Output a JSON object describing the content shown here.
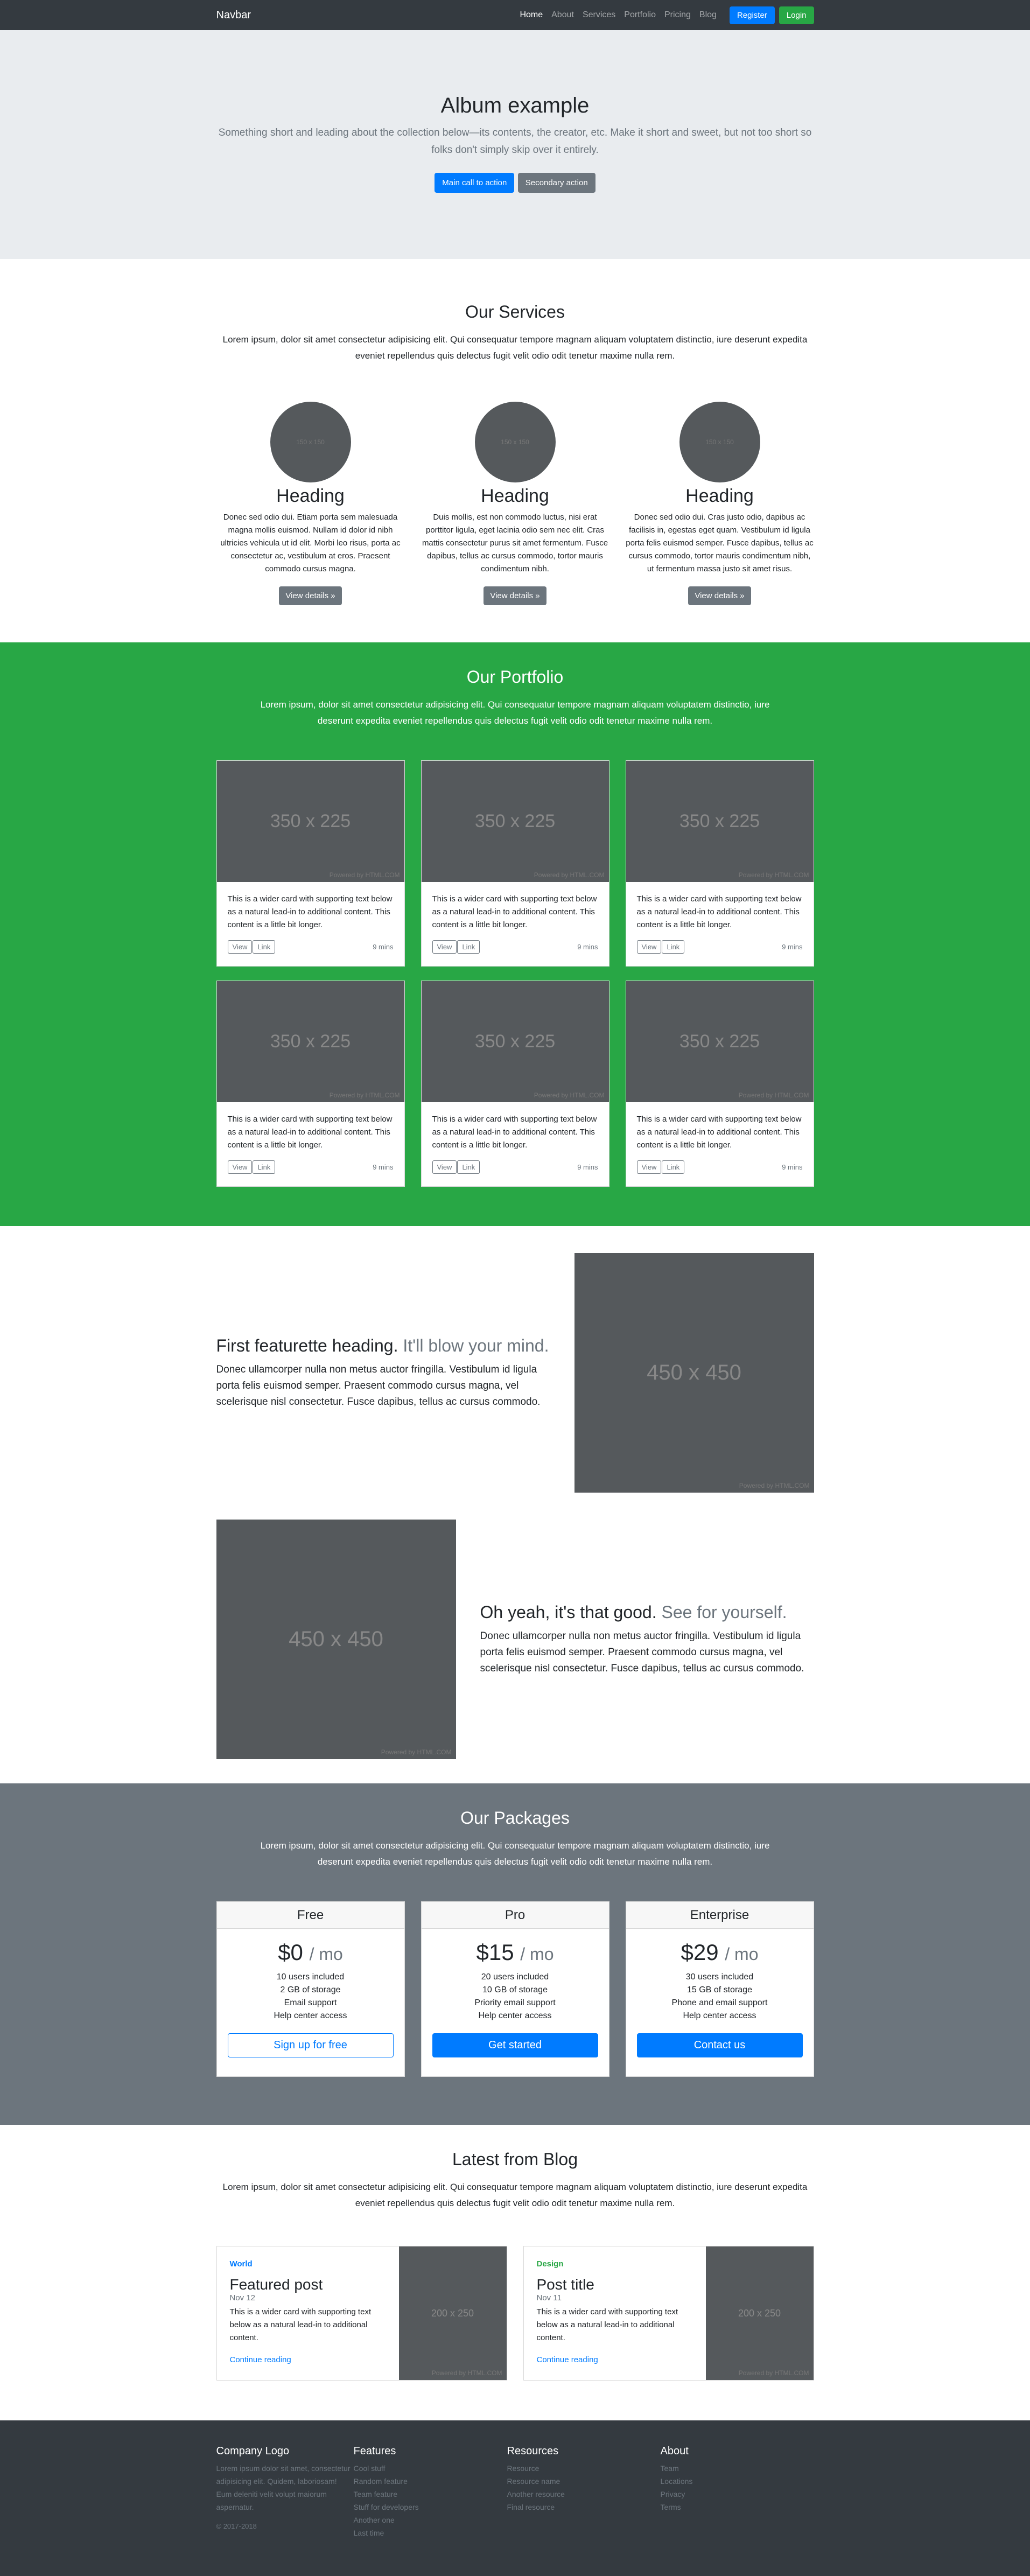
{
  "navbar": {
    "brand": "Navbar",
    "links": [
      "Home",
      "About",
      "Services",
      "Portfolio",
      "Pricing",
      "Blog"
    ],
    "register": "Register",
    "login": "Login"
  },
  "hero": {
    "title": "Album example",
    "lead": "Something short and leading about the collection below—its contents, the creator, etc. Make it short and sweet, but not too short so folks don't simply skip over it entirely.",
    "primary": "Main call to action",
    "secondary": "Secondary action"
  },
  "services": {
    "title": "Our Services",
    "lead": "Lorem ipsum, dolor sit amet consectetur adipisicing elit. Qui consequatur tempore magnam aliquam voluptatem distinctio, iure deserunt expedita eveniet repellendus quis delectus fugit velit odio odit tenetur maxime nulla rem.",
    "items": [
      {
        "placeholder": "150 x 150",
        "heading": "Heading",
        "text": "Donec sed odio dui. Etiam porta sem malesuada magna mollis euismod. Nullam id dolor id nibh ultricies vehicula ut id elit. Morbi leo risus, porta ac consectetur ac, vestibulum at eros. Praesent commodo cursus magna.",
        "button": "View details »"
      },
      {
        "placeholder": "150 x 150",
        "heading": "Heading",
        "text": "Duis mollis, est non commodo luctus, nisi erat porttitor ligula, eget lacinia odio sem nec elit. Cras mattis consectetur purus sit amet fermentum. Fusce dapibus, tellus ac cursus commodo, tortor mauris condimentum nibh.",
        "button": "View details »"
      },
      {
        "placeholder": "150 x 150",
        "heading": "Heading",
        "text": "Donec sed odio dui. Cras justo odio, dapibus ac facilisis in, egestas eget quam. Vestibulum id ligula porta felis euismod semper. Fusce dapibus, tellus ac cursus commodo, tortor mauris condimentum nibh, ut fermentum massa justo sit amet risus.",
        "button": "View details »"
      }
    ]
  },
  "portfolio": {
    "title": "Our Portfolio",
    "lead": "Lorem ipsum, dolor sit amet consectetur adipisicing elit. Qui consequatur tempore magnam aliquam voluptatem distinctio, iure deserunt expedita eveniet repellendus quis delectus fugit velit odio odit tenetur maxime nulla rem.",
    "cards": [
      {
        "placeholder": "350 x 225",
        "powered": "Powered by HTML.COM",
        "text": "This is a wider card with supporting text below as a natural lead-in to additional content. This content is a little bit longer.",
        "view": "View",
        "link": "Link",
        "time": "9 mins"
      },
      {
        "placeholder": "350 x 225",
        "powered": "Powered by HTML.COM",
        "text": "This is a wider card with supporting text below as a natural lead-in to additional content. This content is a little bit longer.",
        "view": "View",
        "link": "Link",
        "time": "9 mins"
      },
      {
        "placeholder": "350 x 225",
        "powered": "Powered by HTML.COM",
        "text": "This is a wider card with supporting text below as a natural lead-in to additional content. This content is a little bit longer.",
        "view": "View",
        "link": "Link",
        "time": "9 mins"
      },
      {
        "placeholder": "350 x 225",
        "powered": "Powered by HTML.COM",
        "text": "This is a wider card with supporting text below as a natural lead-in to additional content. This content is a little bit longer.",
        "view": "View",
        "link": "Link",
        "time": "9 mins"
      },
      {
        "placeholder": "350 x 225",
        "powered": "Powered by HTML.COM",
        "text": "This is a wider card with supporting text below as a natural lead-in to additional content. This content is a little bit longer.",
        "view": "View",
        "link": "Link",
        "time": "9 mins"
      },
      {
        "placeholder": "350 x 225",
        "powered": "Powered by HTML.COM",
        "text": "This is a wider card with supporting text below as a natural lead-in to additional content. This content is a little bit longer.",
        "view": "View",
        "link": "Link",
        "time": "9 mins"
      }
    ]
  },
  "featurettes": [
    {
      "heading": "First featurette heading.",
      "sub": "It'll blow your mind.",
      "lead": "Donec ullamcorper nulla non metus auctor fringilla. Vestibulum id ligula porta felis euismod semper. Praesent commodo cursus magna, vel scelerisque nisl consectetur. Fusce dapibus, tellus ac cursus commodo.",
      "placeholder": "450 x 450",
      "powered": "Powered by HTML.COM"
    },
    {
      "heading": "Oh yeah, it's that good.",
      "sub": "See for yourself.",
      "lead": "Donec ullamcorper nulla non metus auctor fringilla. Vestibulum id ligula porta felis euismod semper. Praesent commodo cursus magna, vel scelerisque nisl consectetur. Fusce dapibus, tellus ac cursus commodo.",
      "placeholder": "450 x 450",
      "powered": "Powered by HTML.COM"
    }
  ],
  "packages": {
    "title": "Our Packages",
    "lead": "Lorem ipsum, dolor sit amet consectetur adipisicing elit. Qui consequatur tempore magnam aliquam voluptatem distinctio, iure deserunt expedita eveniet repellendus quis delectus fugit velit odio odit tenetur maxime nulla rem.",
    "plans": [
      {
        "name": "Free",
        "price": "$0",
        "per": "/ mo",
        "features": [
          "10 users included",
          "2 GB of storage",
          "Email support",
          "Help center access"
        ],
        "button": "Sign up for free"
      },
      {
        "name": "Pro",
        "price": "$15",
        "per": "/ mo",
        "features": [
          "20 users included",
          "10 GB of storage",
          "Priority email support",
          "Help center access"
        ],
        "button": "Get started"
      },
      {
        "name": "Enterprise",
        "price": "$29",
        "per": "/ mo",
        "features": [
          "30 users included",
          "15 GB of storage",
          "Phone and email support",
          "Help center access"
        ],
        "button": "Contact us"
      }
    ]
  },
  "blog": {
    "title": "Latest from Blog",
    "lead": "Lorem ipsum, dolor sit amet consectetur adipisicing elit. Qui consequatur tempore magnam aliquam voluptatem distinctio, iure deserunt expedita eveniet repellendus quis delectus fugit velit odio odit tenetur maxime nulla rem.",
    "posts": [
      {
        "category": "World",
        "title": "Featured post",
        "date": "Nov 12",
        "text": "This is a wider card with supporting text below as a natural lead-in to additional content.",
        "link": "Continue reading",
        "placeholder": "200 x 250",
        "powered": "Powered by HTML.COM"
      },
      {
        "category": "Design",
        "title": "Post title",
        "date": "Nov 11",
        "text": "This is a wider card with supporting text below as a natural lead-in to additional content.",
        "link": "Continue reading",
        "placeholder": "200 x 250",
        "powered": "Powered by HTML.COM"
      }
    ]
  },
  "footer": {
    "logo": "Company Logo",
    "about_text": "Lorem ipsum dolor sit amet, consectetur adipisicing elit. Quidem, laboriosam! Eum deleniti velit volupt maiorum aspernatur.",
    "copyright": "© 2017-2018",
    "cols": [
      {
        "head": "Features",
        "items": [
          "Cool stuff",
          "Random feature",
          "Team feature",
          "Stuff for developers",
          "Another one",
          "Last time"
        ]
      },
      {
        "head": "Resources",
        "items": [
          "Resource",
          "Resource name",
          "Another resource",
          "Final resource"
        ]
      },
      {
        "head": "About",
        "items": [
          "Team",
          "Locations",
          "Privacy",
          "Terms"
        ]
      }
    ]
  },
  "colors": {
    "dark": "#343a40",
    "primary": "#007bff",
    "success": "#28a745",
    "secondary": "#6c757d",
    "light": "#e9ecef"
  }
}
